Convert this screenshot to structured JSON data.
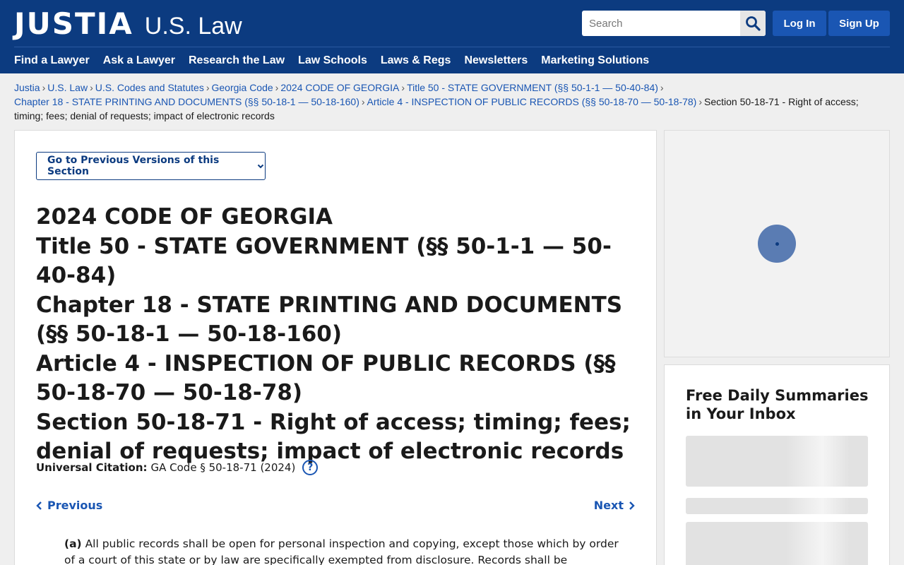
{
  "header": {
    "logo_main": "JUSTIA",
    "logo_sub": "U.S. Law",
    "search_placeholder": "Search",
    "login_label": "Log In",
    "signup_label": "Sign Up",
    "brand_color": "#0c3b80"
  },
  "nav": [
    "Find a Lawyer",
    "Ask a Lawyer",
    "Research the Law",
    "Law Schools",
    "Laws & Regs",
    "Newsletters",
    "Marketing Solutions"
  ],
  "breadcrumb": {
    "links": [
      "Justia",
      "U.S. Law",
      "U.S. Codes and Statutes",
      "Georgia Code",
      "2024 CODE OF GEORGIA",
      "Title 50 - STATE GOVERNMENT (§§ 50-1-1 — 50-40-84)",
      "Chapter 18 - STATE PRINTING AND DOCUMENTS (§§ 50-18-1 — 50-18-160)",
      "Article 4 - INSPECTION OF PUBLIC RECORDS (§§ 50-18-70 — 50-18-78)"
    ],
    "separator": "›",
    "current": "Section 50-18-71 - Right of access; timing; fees; denial of requests; impact of electronic records"
  },
  "main": {
    "versions_button": "Go to Previous Versions of this Section",
    "heading_lines": [
      "2024 CODE OF GEORGIA",
      "Title 50 - STATE GOVERNMENT (§§ 50-1-1 — 50-40-84)",
      "Chapter 18 - STATE PRINTING AND DOCUMENTS (§§ 50-18-1 — 50-18-160)",
      "Article 4 - INSPECTION OF PUBLIC RECORDS (§§ 50-18-70 — 50-18-78)",
      "Section 50-18-71 - Right of access; timing; fees; denial of requests; impact of electronic records"
    ],
    "citation_label": "Universal Citation:",
    "citation_value": "GA Code § 50-18-71 (2024)",
    "help_symbol": "?",
    "previous_label": "Previous",
    "next_label": "Next",
    "paragraph_marker": "(a)",
    "paragraph_text": "All public records shall be open for personal inspection and copying, except those which by order of a court of this state or by law are specifically exempted from disclosure. Records shall be maintained by"
  },
  "sidebar": {
    "newsletter_title": "Free Daily Summaries in Your Inbox"
  }
}
